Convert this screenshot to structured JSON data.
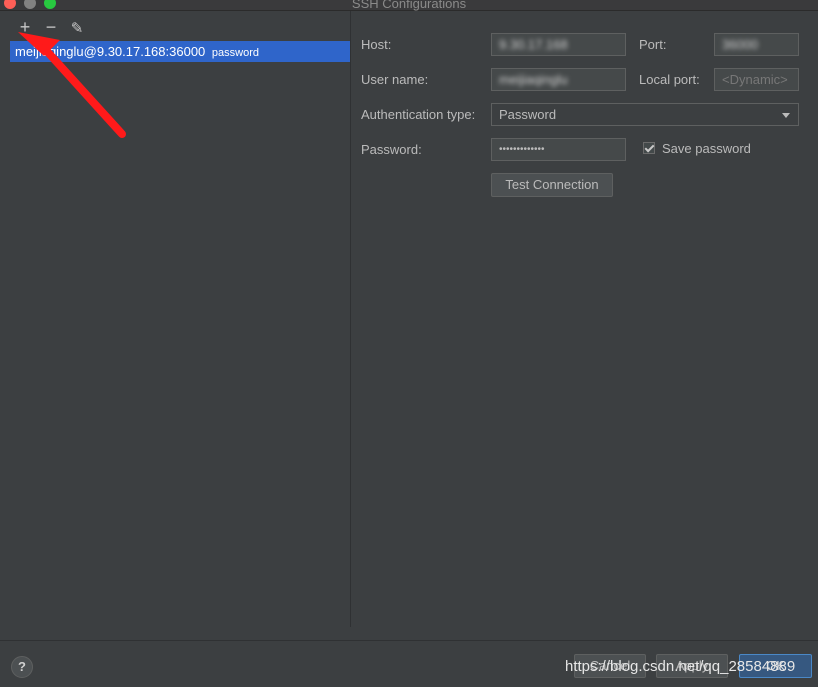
{
  "window": {
    "title": "SSH Configurations"
  },
  "toolbar": {
    "add_icon": "+",
    "remove_icon": "−",
    "edit_icon": "✎"
  },
  "config_list": [
    {
      "host": "meijiaqinglu@9.30.17.168:36000",
      "auth_tag": "password"
    }
  ],
  "form": {
    "host_label": "Host:",
    "host_value": "9.30.17.168",
    "port_label": "Port:",
    "port_value": "36000",
    "user_label": "User name:",
    "user_value": "meijiaqinglu",
    "local_port_label": "Local port:",
    "local_port_placeholder": "<Dynamic>",
    "auth_label": "Authentication type:",
    "auth_value": "Password",
    "password_label": "Password:",
    "password_value": "•••••••••••••",
    "save_password_label": "Save password",
    "save_password_checked": true,
    "test_button": "Test Connection"
  },
  "footer": {
    "help": "?",
    "cancel": "Cancel",
    "apply": "Apply",
    "ok": "OK"
  },
  "watermark": "https://blog.csdn.net/qq_28584889",
  "colors": {
    "selection": "#2f65ca",
    "annotation_arrow": "#ff1a1a",
    "ok_accent": "#365880"
  }
}
